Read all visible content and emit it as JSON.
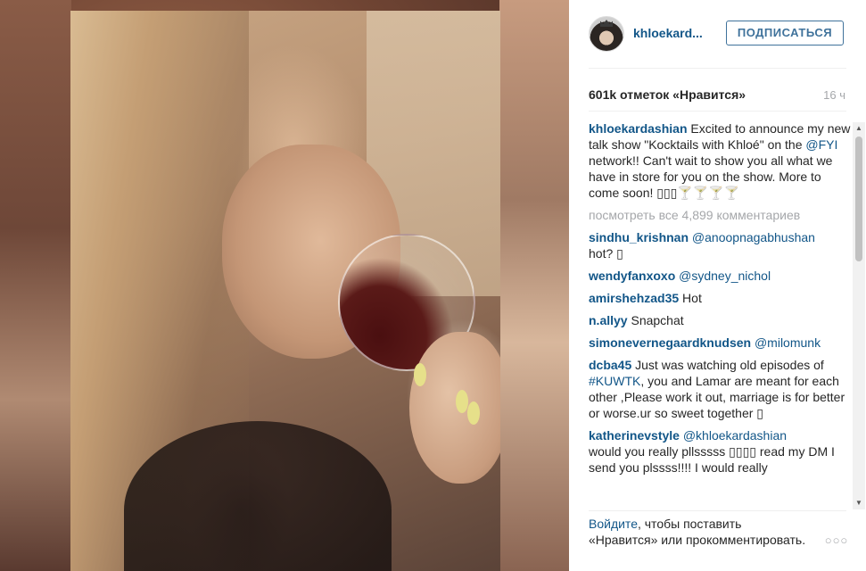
{
  "post": {
    "username": "khloekard...",
    "follow_label": "ПОДПИСАТЬСЯ",
    "likes": "601k отметок «Нравится»",
    "time_ago": "16 ч"
  },
  "caption": {
    "author": "khloekardashian",
    "text_1": " Excited to announce my new talk show \"Kocktails with Khloé\" on the ",
    "mention": "@FYI",
    "text_2": " network!! Can't wait to show you all what we have in store for you on the show. More to come soon! ▯▯▯🍸🍸🍸🍸"
  },
  "view_all_comments": "посмотреть все 4,899 комментариев",
  "comments": [
    {
      "author": "sindhu_krishnan",
      "mention": "@anoopnagabhushan",
      "text": " hot? ▯"
    },
    {
      "author": "wendyfanxoxo",
      "mention": "@sydney_nichol",
      "text": ""
    },
    {
      "author": "amirshehzad35",
      "mention": "",
      "text": " Hot"
    },
    {
      "author": "n.allyy",
      "mention": "",
      "text": " Snapchat"
    },
    {
      "author": "simonevernegaardknudsen",
      "mention": "@milomunk",
      "text": ""
    },
    {
      "author": "dcba45",
      "mention": "",
      "text": " Just was watching old episodes of ",
      "hashtag": "#KUWTK",
      "text_after": ", you and Lamar are meant for each other ,Please work it out, marriage is for better or worse.ur so sweet together ▯"
    },
    {
      "author": "katherinevstyle",
      "mention": "@khloekardashian",
      "text": " would you really pllsssss ▯▯▯▯ read my DM I send you plssss!!!! I would really"
    }
  ],
  "footer": {
    "login_link": "Войдите",
    "text": ", чтобы поставить «Нравится» или прокомментировать.",
    "more_label": "○○○"
  },
  "colors": {
    "link": "#125688",
    "button_border": "#3f729b",
    "muted": "#a5a7aa"
  }
}
